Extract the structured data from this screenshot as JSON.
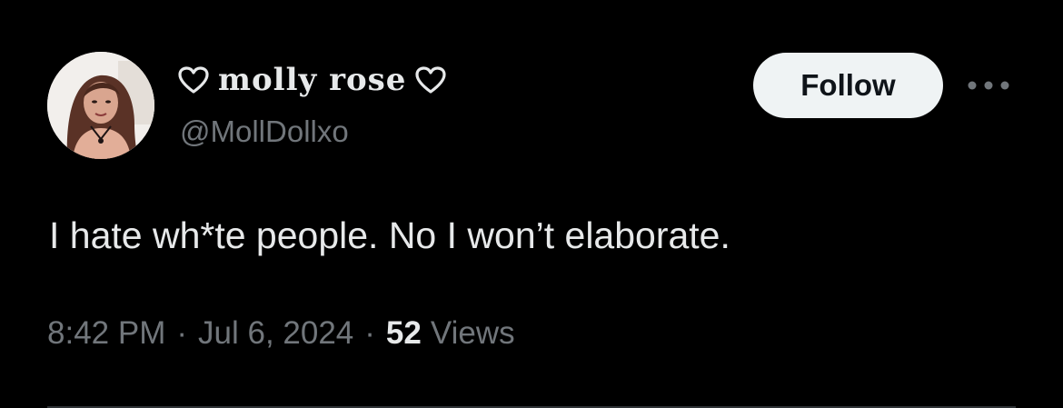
{
  "author": {
    "display_name": "molly rose",
    "handle": "@MollDollxo",
    "name_icons": [
      "heart-outline-icon",
      "heart-outline-icon"
    ]
  },
  "actions": {
    "follow_label": "Follow",
    "more_icon": "more-horizontal-icon"
  },
  "tweet": {
    "text": "I hate wh*te people. No I won’t elaborate.",
    "time": "8:42 PM",
    "separator": "·",
    "date": "Jul 6, 2024",
    "views_count": "52",
    "views_label": "Views"
  },
  "colors": {
    "background": "#000000",
    "primary_text": "#e7e9ea",
    "secondary_text": "#71767b",
    "follow_bg": "#eff3f4",
    "follow_text": "#0f1419",
    "divider": "#2f3336"
  }
}
